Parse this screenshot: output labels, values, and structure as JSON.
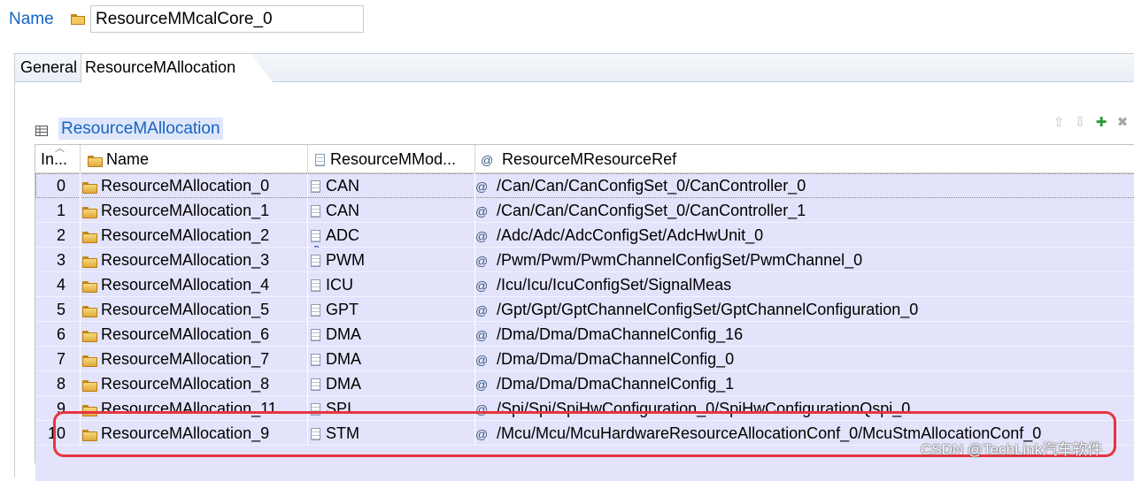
{
  "header": {
    "name_label": "Name",
    "name_value": "ResourceMMcalCore_0"
  },
  "tabs": [
    {
      "label": "General",
      "active": false
    },
    {
      "label": "ResourceMAllocation",
      "active": true
    }
  ],
  "section": {
    "title": "ResourceMAllocation"
  },
  "toolbar": [
    {
      "icon": "arrow-up-icon",
      "glyph": "⇧"
    },
    {
      "icon": "arrow-down-icon",
      "glyph": "⇩"
    },
    {
      "icon": "add-icon",
      "glyph": "✚"
    },
    {
      "icon": "delete-icon",
      "glyph": "✖"
    }
  ],
  "table": {
    "columns": [
      "In...",
      "Name",
      "ResourceMMod...",
      "ResourceMResourceRef"
    ],
    "rows": [
      {
        "index": "0",
        "name": "ResourceMAllocation_0",
        "module": "CAN",
        "ref": "/Can/Can/CanConfigSet_0/CanController_0"
      },
      {
        "index": "1",
        "name": "ResourceMAllocation_1",
        "module": "CAN",
        "ref": "/Can/Can/CanConfigSet_0/CanController_1"
      },
      {
        "index": "2",
        "name": "ResourceMAllocation_2",
        "module": "ADC",
        "ref": "/Adc/Adc/AdcConfigSet/AdcHwUnit_0",
        "module_icon": "blue"
      },
      {
        "index": "3",
        "name": "ResourceMAllocation_3",
        "module": "PWM",
        "ref": "/Pwm/Pwm/PwmChannelConfigSet/PwmChannel_0"
      },
      {
        "index": "4",
        "name": "ResourceMAllocation_4",
        "module": "ICU",
        "ref": "/Icu/Icu/IcuConfigSet/SignalMeas"
      },
      {
        "index": "5",
        "name": "ResourceMAllocation_5",
        "module": "GPT",
        "ref": "/Gpt/Gpt/GptChannelConfigSet/GptChannelConfiguration_0"
      },
      {
        "index": "6",
        "name": "ResourceMAllocation_6",
        "module": "DMA",
        "ref": "/Dma/Dma/DmaChannelConfig_16"
      },
      {
        "index": "7",
        "name": "ResourceMAllocation_7",
        "module": "DMA",
        "ref": "/Dma/Dma/DmaChannelConfig_0"
      },
      {
        "index": "8",
        "name": "ResourceMAllocation_8",
        "module": "DMA",
        "ref": "/Dma/Dma/DmaChannelConfig_1"
      },
      {
        "index": "9",
        "name": "ResourceMAllocation_11",
        "module": "SPI",
        "ref": "/Spi/Spi/SpiHwConfiguration_0/SpiHwConfigurationQspi_0"
      },
      {
        "index": "10",
        "name": "ResourceMAllocation_9",
        "module": "STM",
        "ref": "/Mcu/Mcu/McuHardwareResourceAllocationConf_0/McuStmAllocationConf_0"
      }
    ]
  },
  "watermark": "CSDN @TechLink汽车软件",
  "colors": {
    "link_blue": "#1565c0",
    "row_bg": "#e3e3fb",
    "highlight_red": "#e8343f"
  }
}
